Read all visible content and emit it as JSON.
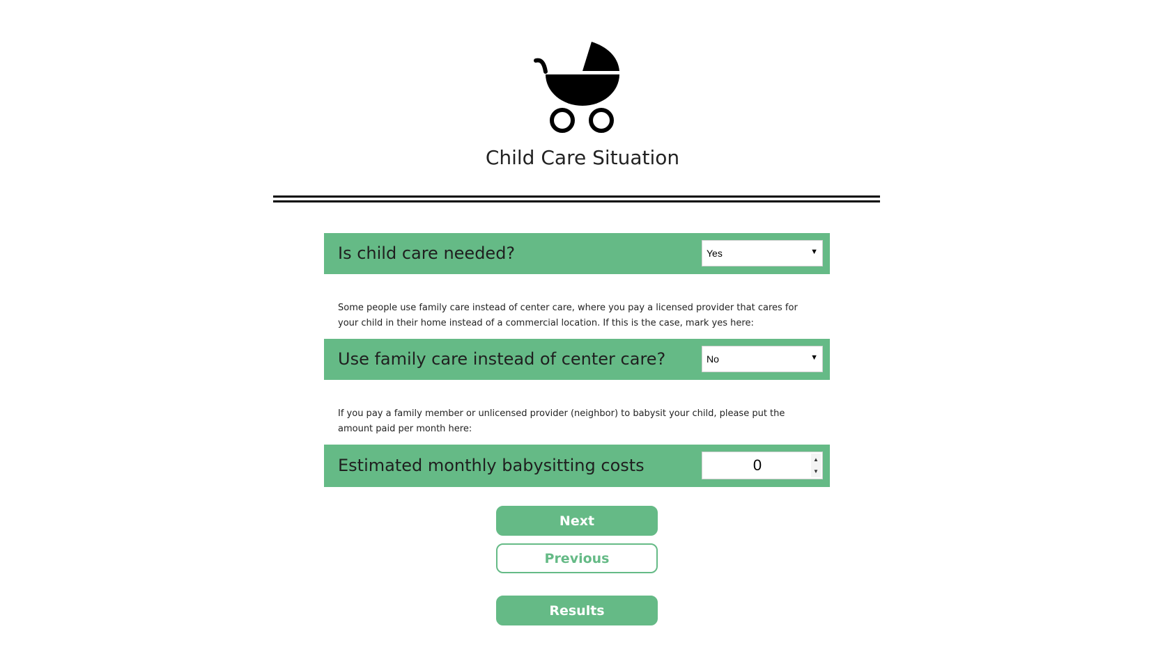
{
  "header": {
    "icon": "baby-stroller-icon",
    "title": "Child Care Situation"
  },
  "questions": [
    {
      "label": "Is child care needed?",
      "control": "select",
      "value": "Yes"
    },
    {
      "label": "Use family care instead of center care?",
      "control": "select",
      "value": "No"
    },
    {
      "label": "Estimated monthly babysitting costs",
      "control": "number",
      "value": "0"
    }
  ],
  "help": {
    "family_care": "Some people use family care instead of center care, where you pay a licensed provider that cares for your child in their home instead of a commercial location. If this is the case, mark yes here:",
    "babysitting": "If you pay a family member or unlicensed provider (neighbor) to babysit your child, please put the amount paid per month here:"
  },
  "buttons": {
    "next": "Next",
    "previous": "Previous",
    "results": "Results"
  },
  "colors": {
    "accent": "#65ba86",
    "text": "#222222",
    "divider": "#000000"
  }
}
